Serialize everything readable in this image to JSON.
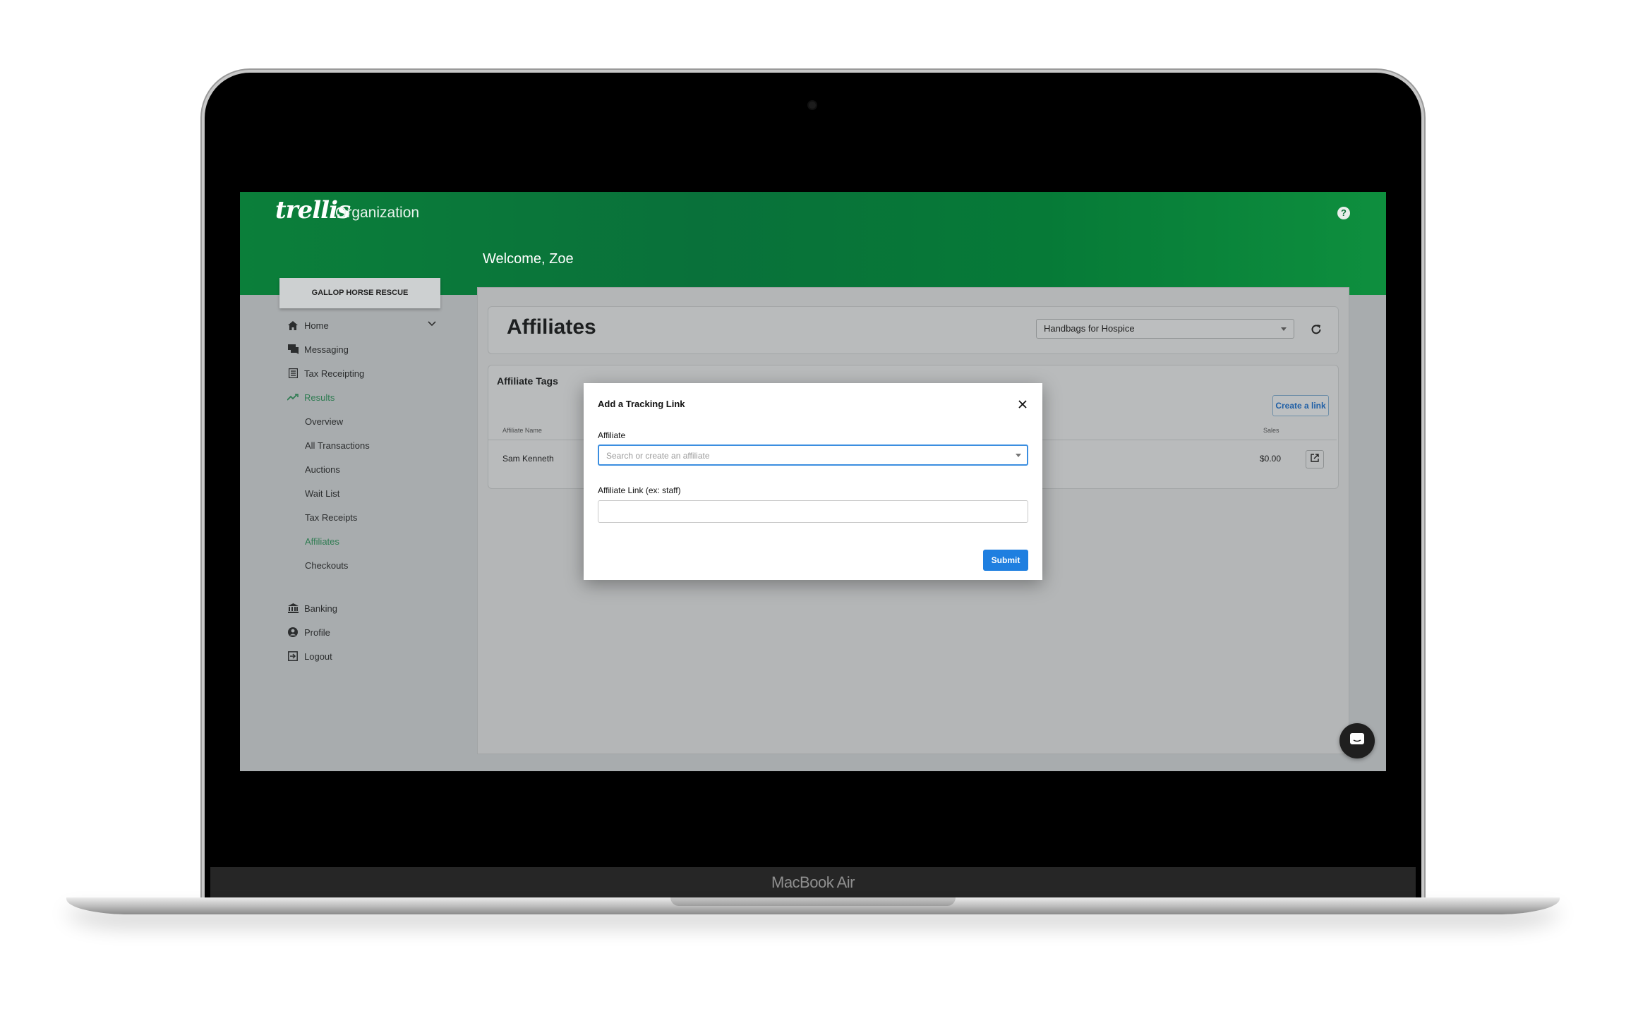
{
  "device": {
    "label": "MacBook Air"
  },
  "app": {
    "logo_text": "trellis",
    "logo_subtitle": "Organization",
    "welcome": "Welcome, Zoe"
  },
  "sidebar": {
    "org_name": "GALLOP HORSE RESCUE",
    "items": [
      {
        "label": "Home",
        "icon": "home-icon"
      },
      {
        "label": "Messaging",
        "icon": "messaging-icon"
      },
      {
        "label": "Tax Receipting",
        "icon": "receipt-icon"
      },
      {
        "label": "Results",
        "icon": "trending-icon"
      }
    ],
    "results_sub": [
      "Overview",
      "All Transactions",
      "Auctions",
      "Wait List",
      "Tax Receipts",
      "Affiliates",
      "Checkouts"
    ],
    "bottom_items": [
      {
        "label": "Banking",
        "icon": "bank-icon"
      },
      {
        "label": "Profile",
        "icon": "profile-icon"
      },
      {
        "label": "Logout",
        "icon": "logout-icon"
      }
    ]
  },
  "page": {
    "title": "Affiliates",
    "event_select": "Handbags for Hospice"
  },
  "tags": {
    "title": "Affiliate Tags",
    "create_link": "Create a link",
    "columns": [
      "Affiliate Name",
      "Sales"
    ],
    "rows": [
      {
        "name": "Sam Kenneth",
        "sales": "$0.00"
      }
    ]
  },
  "modal": {
    "title": "Add a Tracking Link",
    "affiliate_label": "Affiliate",
    "affiliate_placeholder": "Search or create an affiliate",
    "link_label": "Affiliate Link (ex: staff)",
    "link_value": "",
    "submit": "Submit"
  },
  "colors": {
    "brand_green": "#0b7f3a",
    "active_nav": "#2f7c52",
    "primary_button": "#1f7fe0"
  }
}
